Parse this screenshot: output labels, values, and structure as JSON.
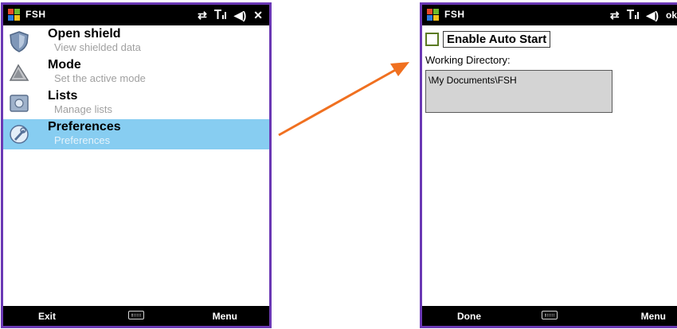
{
  "left_screen": {
    "app_title": "FSH",
    "status_icons": [
      "sync-icon",
      "signal-icon",
      "volume-icon",
      "close-icon"
    ],
    "menu_items": [
      {
        "title": "Open shield",
        "subtitle": "View shielded data",
        "icon": "shield-icon"
      },
      {
        "title": "Mode",
        "subtitle": "Set the active mode",
        "icon": "mode-icon"
      },
      {
        "title": "Lists",
        "subtitle": "Manage lists",
        "icon": "lists-icon"
      },
      {
        "title": "Preferences",
        "subtitle": "Preferences",
        "icon": "preferences-icon",
        "selected": true
      }
    ],
    "softkeys": {
      "left": "Exit",
      "right": "Menu"
    }
  },
  "right_screen": {
    "app_title": "FSH",
    "status_icons": [
      "sync-icon",
      "signal-icon",
      "volume-icon"
    ],
    "status_ok": "ok",
    "auto_start": {
      "label": "Enable Auto Start",
      "checked": false
    },
    "working_directory": {
      "label": "Working Directory:",
      "value": "\\My Documents\\FSH"
    },
    "softkeys": {
      "left": "Done",
      "right": "Menu"
    }
  },
  "colors": {
    "frame": "#6a38b4",
    "selection": "#87cdf1",
    "arrow": "#f07020",
    "bar": "#000000"
  }
}
